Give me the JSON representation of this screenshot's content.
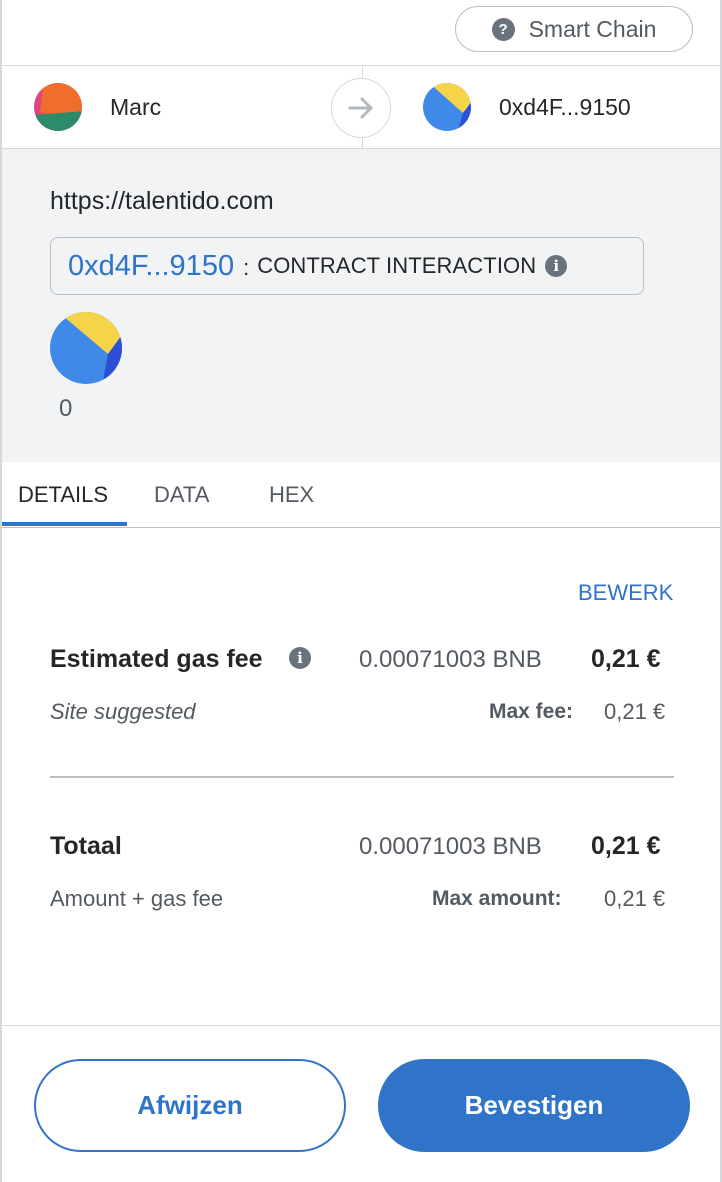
{
  "network": {
    "name": "Smart Chain",
    "help_glyph": "?"
  },
  "sender": {
    "name": "Marc"
  },
  "recipient": {
    "name": "0xd4F...9150"
  },
  "transaction": {
    "origin": "https://talentido.com",
    "contract_address": "0xd4F...9150",
    "separator": ":",
    "method_label": "CONTRACT INTERACTION",
    "token_amount": "0"
  },
  "tabs": [
    {
      "label": "DETAILS",
      "active": true
    },
    {
      "label": "DATA",
      "active": false
    },
    {
      "label": "HEX",
      "active": false
    }
  ],
  "details": {
    "edit_label": "BEWERK",
    "gas": {
      "label": "Estimated gas fee",
      "native_value": "0.00071003 BNB",
      "fiat_value": "0,21 €",
      "source_label": "Site suggested",
      "max_label": "Max fee:",
      "max_value": "0,21 €"
    },
    "total": {
      "label": "Totaal",
      "native_value": "0.00071003 BNB",
      "fiat_value": "0,21 €",
      "sub_label": "Amount + gas fee",
      "max_label": "Max amount:",
      "max_value": "0,21 €"
    }
  },
  "footer": {
    "reject_label": "Afwijzen",
    "confirm_label": "Bevestigen"
  },
  "colors": {
    "accent": "#2f74c8",
    "summary_bg": "#f2f3f4",
    "text_muted": "#535a61"
  },
  "icons": [
    "question-icon",
    "arrow-right-icon",
    "info-icon"
  ]
}
